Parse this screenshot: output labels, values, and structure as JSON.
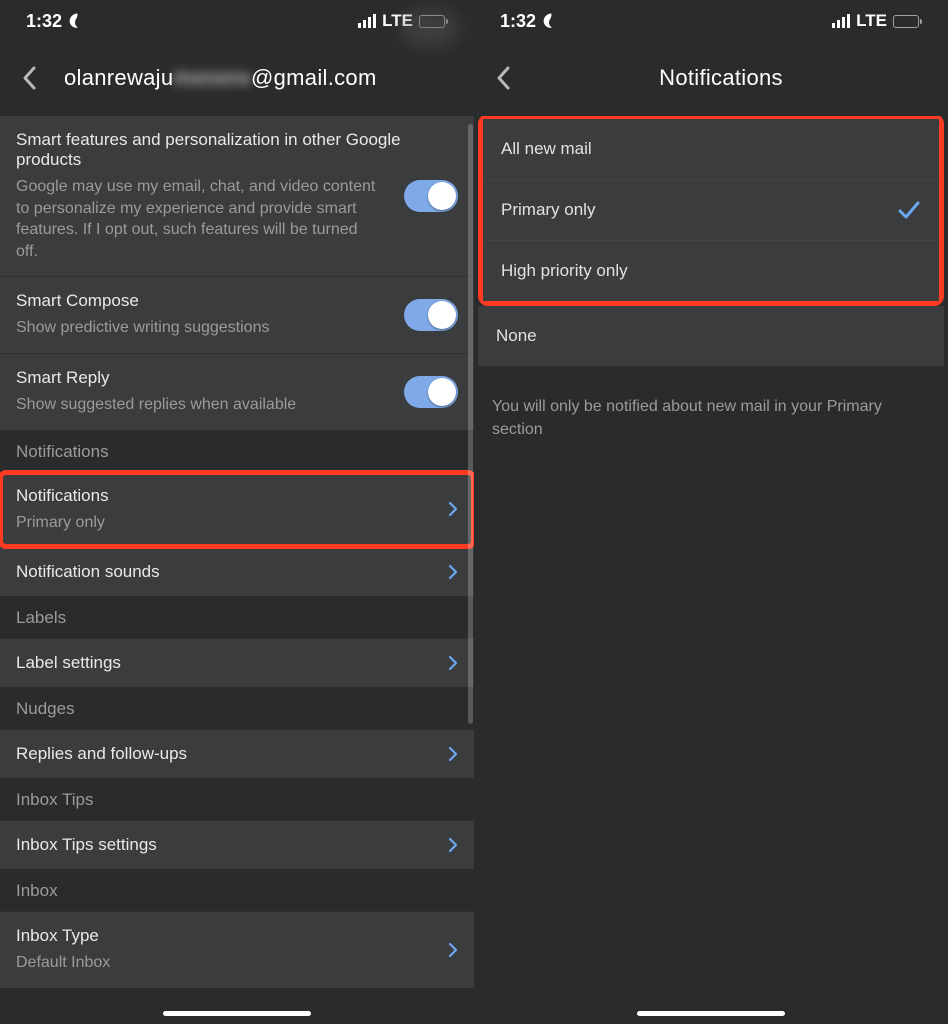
{
  "status": {
    "time": "1:32",
    "carrier": "LTE"
  },
  "left": {
    "title_prefix": "olanrewaju",
    "title_blur": "mxnxnx",
    "title_suffix": "@gmail.com",
    "smart_block": {
      "title": "Smart features and personalization in other Google products",
      "desc": "Google may use my email, chat, and video content to personalize my experience and provide smart features. If I opt out, such features will be turned off."
    },
    "smart_compose": {
      "title": "Smart Compose",
      "sub": "Show predictive writing suggestions"
    },
    "smart_reply": {
      "title": "Smart Reply",
      "sub": "Show suggested replies when available"
    },
    "sections": {
      "notifications_header": "Notifications",
      "notifications_row": {
        "title": "Notifications",
        "sub": "Primary only"
      },
      "notification_sounds": "Notification sounds",
      "labels_header": "Labels",
      "label_settings": "Label settings",
      "nudges_header": "Nudges",
      "replies": "Replies and follow-ups",
      "inboxtips_header": "Inbox Tips",
      "inboxtips_settings": "Inbox Tips settings",
      "inbox_header": "Inbox",
      "inbox_type": {
        "title": "Inbox Type",
        "sub": "Default Inbox"
      }
    }
  },
  "right": {
    "title": "Notifications",
    "options": {
      "all": "All new mail",
      "primary": "Primary only",
      "high": "High priority only",
      "none": "None"
    },
    "footer": "You will only be notified about new mail in your Primary section"
  }
}
